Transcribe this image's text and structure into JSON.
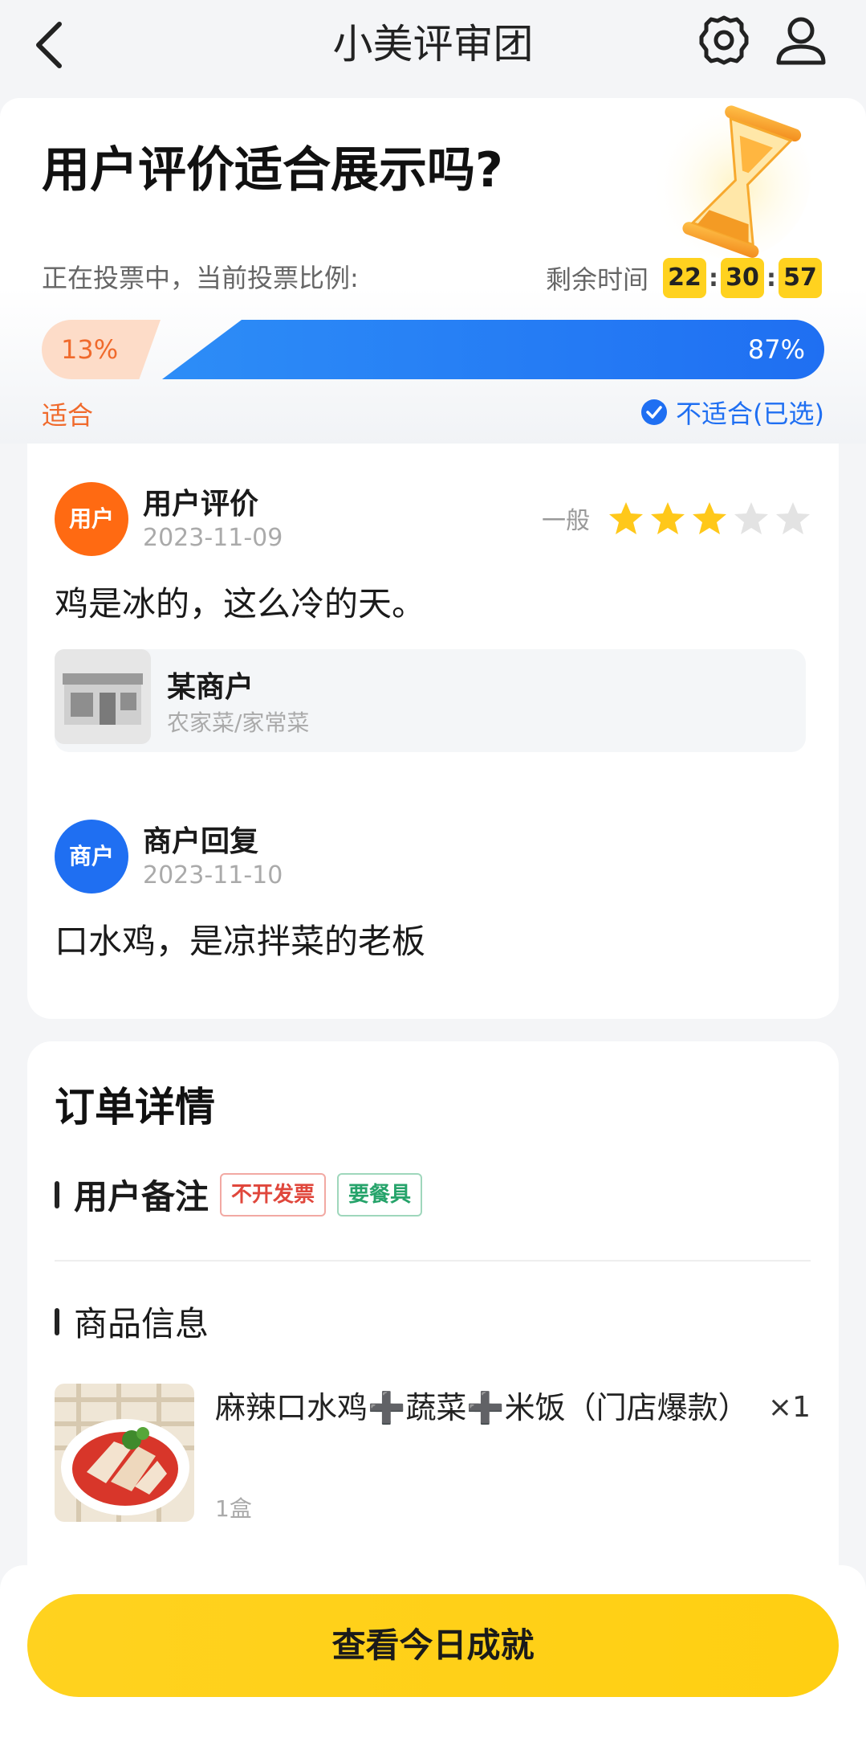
{
  "nav": {
    "title": "小美评审团",
    "icons": [
      "back-icon",
      "gear-icon",
      "user-icon"
    ]
  },
  "header": {
    "question": "用户评价适合展示吗?",
    "vote_status": "正在投票中，当前投票比例:",
    "timer_label": "剩余时间",
    "timer": {
      "hours": "22",
      "minutes": "30",
      "seconds": "57"
    },
    "vote": {
      "suitable_percent": "13%",
      "unsuitable_percent": "87%",
      "suitable_fraction": 0.13,
      "unsuitable_fraction": 0.87,
      "suitable_label": "适合",
      "unsuitable_label": "不适合(已选)"
    }
  },
  "review": {
    "avatar_label": "用户",
    "title": "用户评价",
    "date": "2023-11-09",
    "rating_text": "一般",
    "rating_stars": 3,
    "rating_max": 5,
    "text": "鸡是冰的，这么冷的天。",
    "merchant": {
      "name": "某商户",
      "category": "农家菜/家常菜"
    }
  },
  "reply": {
    "avatar_label": "商户",
    "title": "商户回复",
    "date": "2023-11-10",
    "text": "口水鸡，是凉拌菜的老板"
  },
  "order": {
    "title": "订单详情",
    "remarks_label": "用户备注",
    "tags": [
      "不开发票",
      "要餐具"
    ],
    "product_section_label": "商品信息",
    "product": {
      "name": "麻辣口水鸡➕蔬菜➕米饭（门店爆款）",
      "qty": "×1",
      "unit": "1盒"
    }
  },
  "footer": {
    "cta": "查看今日成就"
  },
  "colors": {
    "accent_yellow": "#ffd21f",
    "blue": "#1f6ff2",
    "orange": "#f06a2c"
  }
}
